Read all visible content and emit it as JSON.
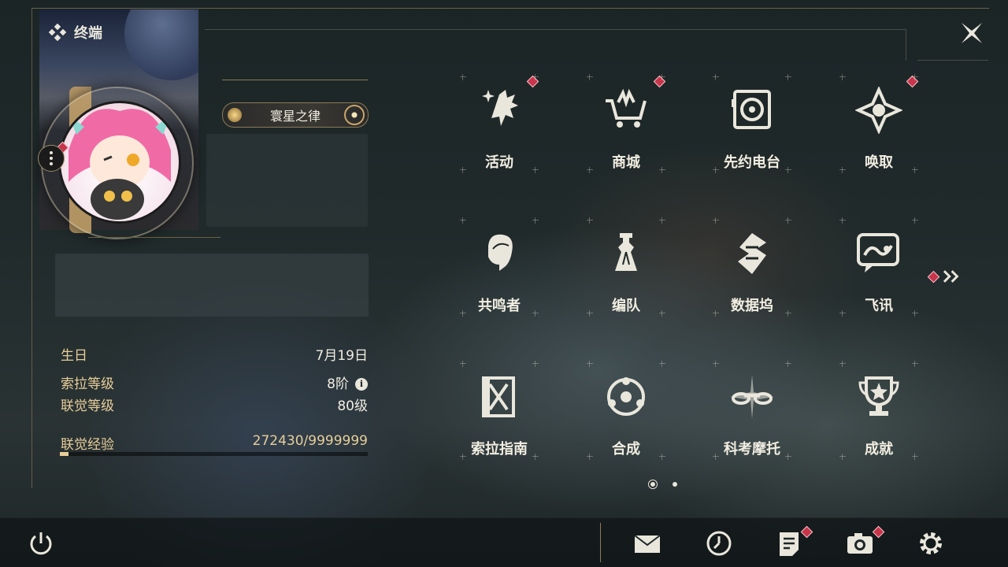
{
  "header": {
    "title": "终端"
  },
  "profile": {
    "name_tag": "寰星之律"
  },
  "stats": [
    {
      "label": "生日",
      "value": "7月19日"
    },
    {
      "label": "索拉等级",
      "value": "8阶"
    },
    {
      "label": "联觉等级",
      "value": "80级"
    }
  ],
  "experience": {
    "label": "联觉经验",
    "value": "272430/9999999",
    "progress": 0.027
  },
  "grid": [
    {
      "label": "活动",
      "icon": "activity-icon",
      "badge": true
    },
    {
      "label": "商城",
      "icon": "shop-cart-icon",
      "badge": true
    },
    {
      "label": "先约电台",
      "icon": "radio-icon",
      "badge": false
    },
    {
      "label": "唤取",
      "icon": "summon-compass-icon",
      "badge": true
    },
    {
      "label": "共鸣者",
      "icon": "resonator-icon",
      "badge": false
    },
    {
      "label": "编队",
      "icon": "team-chess-icon",
      "badge": false
    },
    {
      "label": "数据坞",
      "icon": "databank-icon",
      "badge": false
    },
    {
      "label": "飞讯",
      "icon": "message-icon",
      "badge": false
    },
    {
      "label": "索拉指南",
      "icon": "guide-book-icon",
      "badge": false
    },
    {
      "label": "合成",
      "icon": "synthesis-icon",
      "badge": false
    },
    {
      "label": "科考摩托",
      "icon": "motorcycle-icon",
      "badge": false
    },
    {
      "label": "成就",
      "icon": "trophy-icon",
      "badge": false
    }
  ],
  "pagination": {
    "current": 1,
    "total": 2
  },
  "colors": {
    "accent_gold": "#e7ce9a",
    "badge_red": "#c8344a",
    "line_gold": "#8d7b57"
  }
}
